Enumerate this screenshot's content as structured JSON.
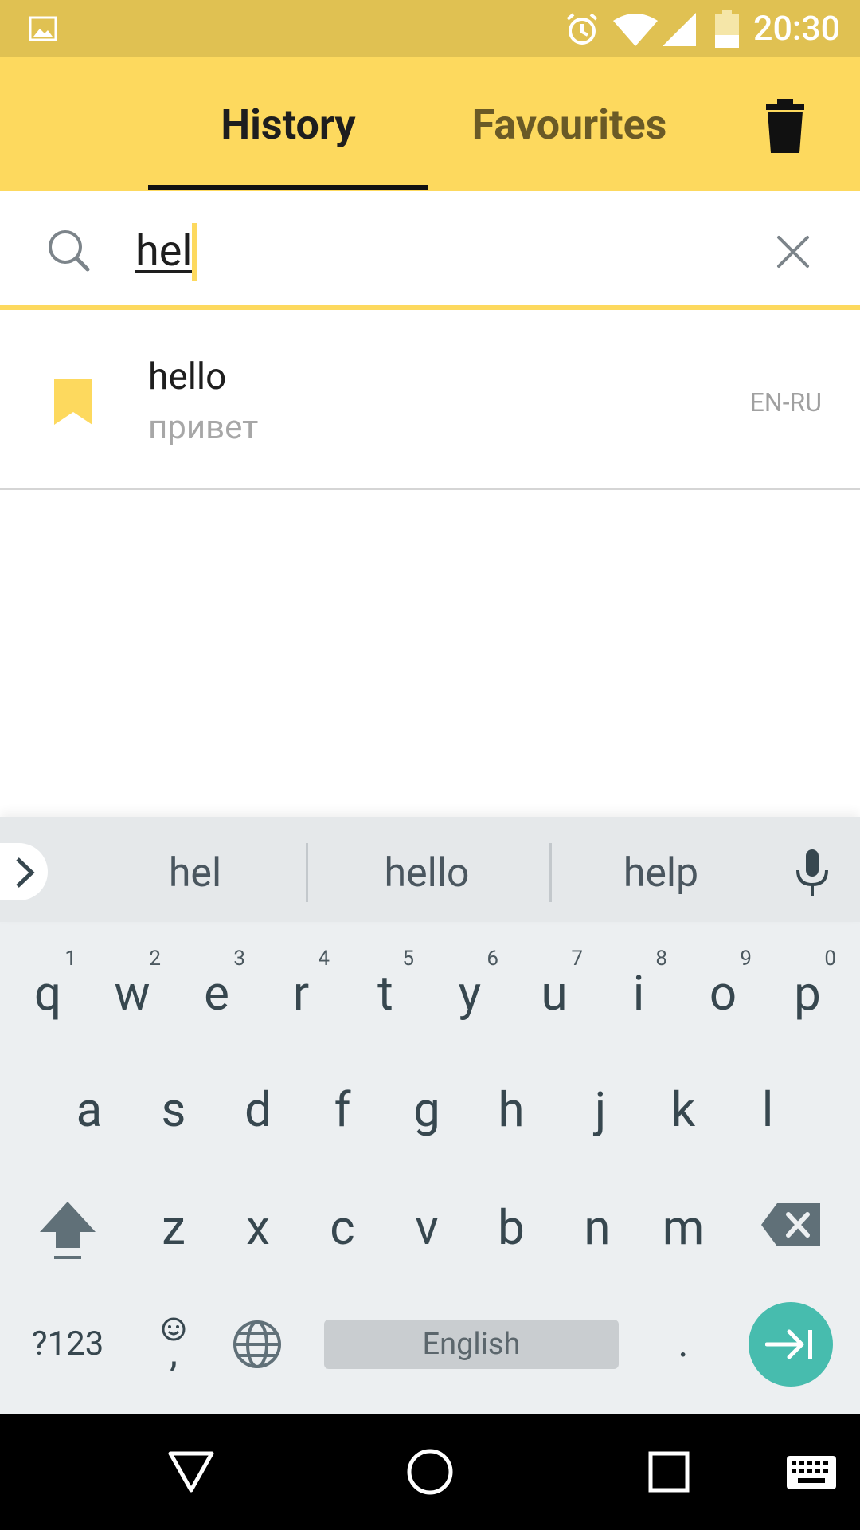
{
  "status_bar": {
    "time": "20:30",
    "icons": [
      "gallery-icon",
      "alarm-icon",
      "wifi-icon",
      "cell-signal-icon",
      "battery-icon"
    ]
  },
  "tabs": {
    "history_label": "History",
    "favourites_label": "Favourites",
    "active": "History"
  },
  "search": {
    "value": "hel",
    "placeholder": ""
  },
  "history_items": [
    {
      "word": "hello",
      "translation": "привет",
      "lang_pair": "EN-RU",
      "bookmarked": true
    }
  ],
  "keyboard": {
    "suggestions": [
      "hel",
      "hello",
      "help"
    ],
    "row1": [
      {
        "key": "q",
        "hint": "1"
      },
      {
        "key": "w",
        "hint": "2"
      },
      {
        "key": "e",
        "hint": "3"
      },
      {
        "key": "r",
        "hint": "4"
      },
      {
        "key": "t",
        "hint": "5"
      },
      {
        "key": "y",
        "hint": "6"
      },
      {
        "key": "u",
        "hint": "7"
      },
      {
        "key": "i",
        "hint": "8"
      },
      {
        "key": "o",
        "hint": "9"
      },
      {
        "key": "p",
        "hint": "0"
      }
    ],
    "row2": [
      "a",
      "s",
      "d",
      "f",
      "g",
      "h",
      "j",
      "k",
      "l"
    ],
    "row3": [
      "z",
      "x",
      "c",
      "v",
      "b",
      "n",
      "m"
    ],
    "symbols_label": "?123",
    "comma_label": ",",
    "space_label": "English",
    "period_label": "."
  },
  "colors": {
    "status_bar": "#e0c152",
    "header": "#fdd95e",
    "accent_teal": "#47bcae",
    "bookmark": "#fdd95e"
  }
}
